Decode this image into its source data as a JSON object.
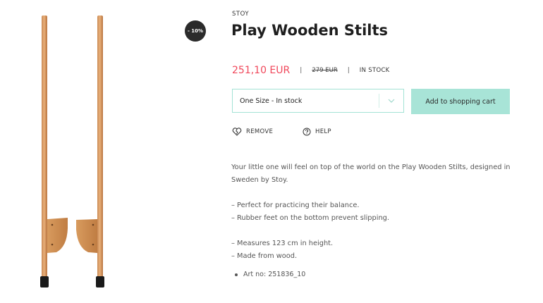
{
  "product": {
    "brand": "STOY",
    "title": "Play Wooden Stilts",
    "discount_badge": "- 10%",
    "price": "251,10 EUR",
    "separator": "|",
    "original_price": "279 EUR",
    "stock_status": "IN STOCK"
  },
  "size_select": {
    "value": "One Size - In stock"
  },
  "buttons": {
    "add_to_cart": "Add to shopping cart",
    "remove": "REMOVE",
    "help": "HELP"
  },
  "description": {
    "intro": "Your little one will feel on top of the world on the Play Wooden Stilts, designed in Sweden by Stoy.",
    "bullets_a": [
      "– Perfect for practicing their balance.",
      "– Rubber feet on the bottom prevent slipping."
    ],
    "bullets_b": [
      "– Measures 123 cm in height.",
      "– Made from wood."
    ],
    "art_no": "Art no: 251836_10"
  },
  "colors": {
    "accent": "#a8e4d7",
    "price": "#f0475a",
    "badge": "#2b2b2b"
  },
  "icons": [
    "heart-broken-icon",
    "help-circle-icon",
    "chevron-down-icon"
  ]
}
